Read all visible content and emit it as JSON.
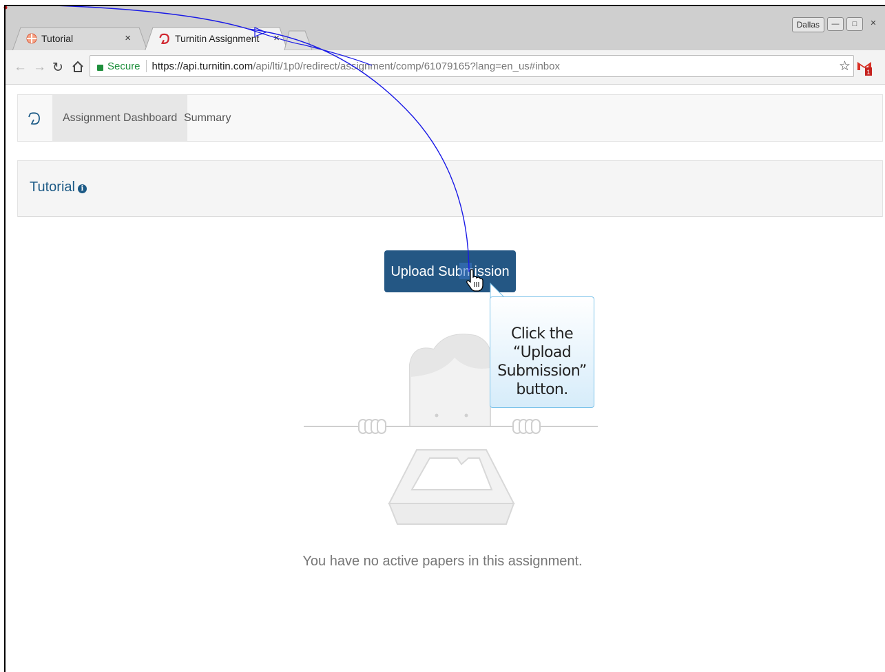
{
  "browser": {
    "tabs": [
      {
        "label": "Tutorial",
        "close": "×"
      },
      {
        "label": "Turnitin Assignment",
        "close": "×"
      }
    ],
    "user_name": "Dallas",
    "url": {
      "secure_label": "Secure",
      "host": "https://api.turnitin.com",
      "path": "/api/lti/1p0/redirect/assignment/comp/61079165?lang=en_us#inbox"
    },
    "gmail_count": "1"
  },
  "navbar": {
    "items": [
      {
        "label": "Assignment Dashboard",
        "active": true
      },
      {
        "label": "Summary",
        "active": false
      }
    ]
  },
  "panel": {
    "title": "Tutorial"
  },
  "upload_button": {
    "label": "Upload Submission"
  },
  "callout": {
    "text_line1": "Click the “Upload",
    "text_line2": "Submission”",
    "text_line3": "button."
  },
  "empty_state": {
    "message": "You have no active papers in this assignment."
  },
  "colors": {
    "primary": "#245784",
    "title": "#1c5a86",
    "callout_border": "#7cc3ea",
    "annotation": "#0000ee"
  }
}
